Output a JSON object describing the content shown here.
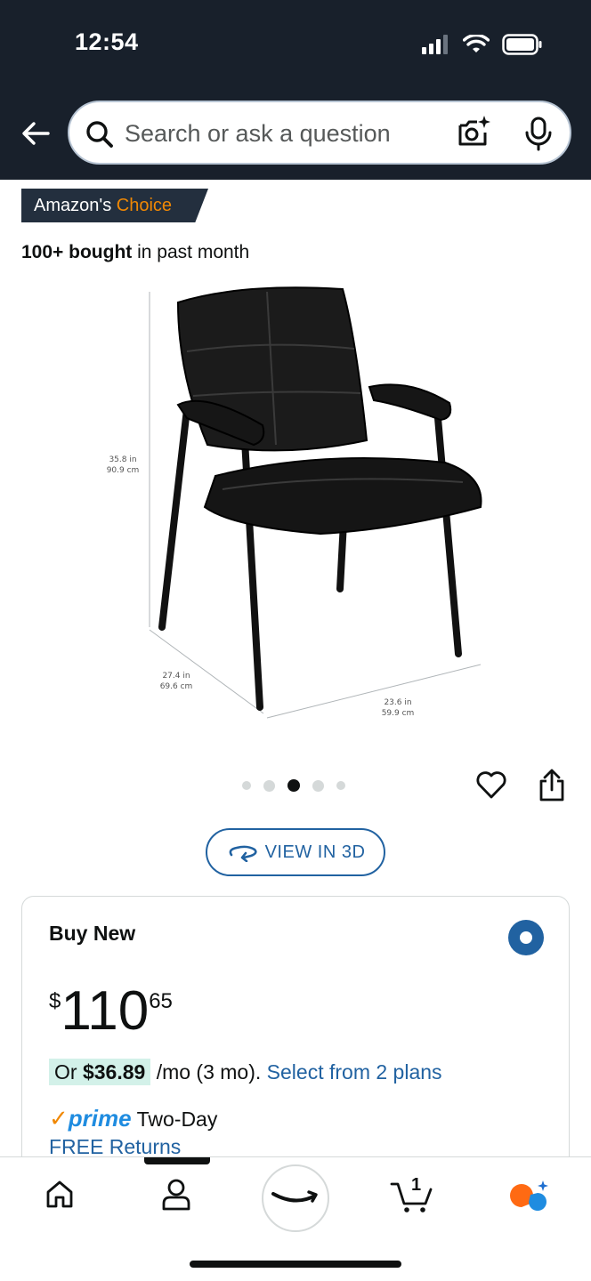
{
  "status_bar": {
    "time": "12:54"
  },
  "search": {
    "placeholder": "Search or ask a question"
  },
  "badge": {
    "prefix": "Amazon's ",
    "highlight": "Choice"
  },
  "bought": {
    "bold": "100+ bought",
    "rest": " in past month"
  },
  "dimensions": {
    "height_in": "35.8 in",
    "height_cm": "90.9 cm",
    "depth_in": "27.4 in",
    "depth_cm": "69.6 cm",
    "width_in": "23.6 in",
    "width_cm": "59.9 cm"
  },
  "carousel": {
    "count": 5,
    "active_index": 2
  },
  "view3d": {
    "label": "VIEW IN 3D"
  },
  "buy_box": {
    "title": "Buy New",
    "currency": "$",
    "price_whole": "110",
    "price_fraction": "65",
    "plan_prefix": "Or ",
    "plan_amount": "$36.89",
    "plan_terms": " /mo (3 mo). ",
    "plan_link": "Select from 2 plans",
    "prime_label": "prime",
    "prime_check": "✓",
    "delivery": "Two-Day",
    "returns": "FREE Returns"
  },
  "bottom_nav": {
    "cart_count": "1"
  },
  "colors": {
    "header_bg": "#18202b",
    "link": "#2162a1",
    "orange": "#f08804",
    "prime_blue": "#1f8ce0"
  }
}
